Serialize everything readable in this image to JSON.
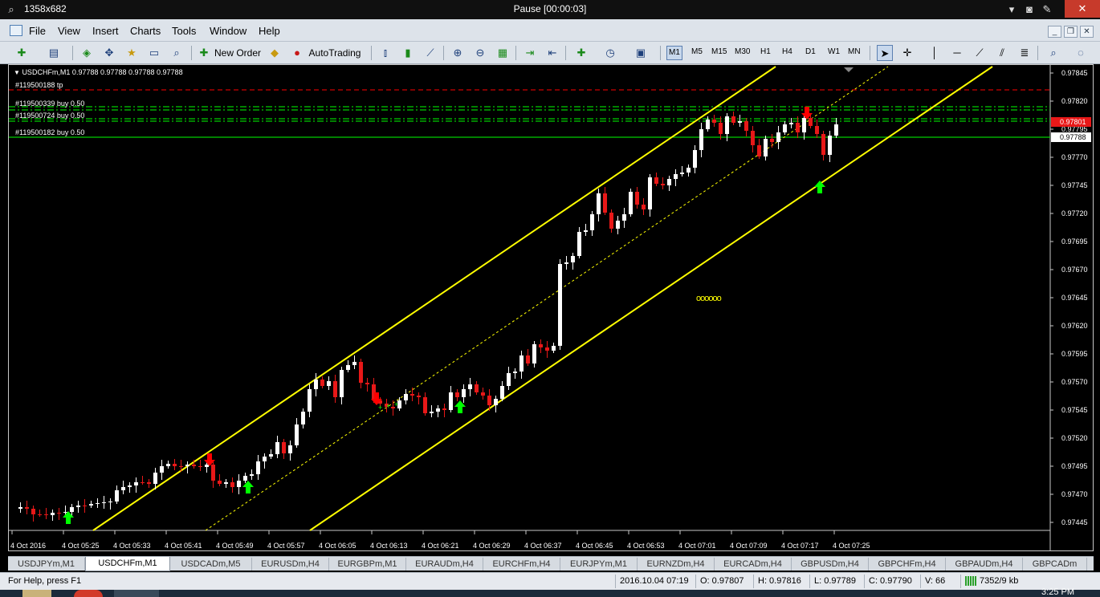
{
  "window": {
    "resolution": "1358x682",
    "status": "Pause [00:00:03]"
  },
  "menu": [
    "File",
    "View",
    "Insert",
    "Charts",
    "Tools",
    "Window",
    "Help"
  ],
  "toolbar": {
    "new_order": "New Order",
    "auto_trading": "AutoTrading",
    "timeframes": [
      "M1",
      "M5",
      "M15",
      "M30",
      "H1",
      "H4",
      "D1",
      "W1",
      "MN"
    ],
    "active_timeframe": "M1"
  },
  "chart": {
    "header": "USDCHFm,M1  0.97788 0.97788 0.97788 0.97788",
    "bid_price": "0.97788",
    "ask_price": "0.97801",
    "price_axis": [
      "0.97845",
      "0.97820",
      "0.97795",
      "0.97770",
      "0.97745",
      "0.97720",
      "0.97695",
      "0.97670",
      "0.97645",
      "0.97620",
      "0.97595",
      "0.97570",
      "0.97545",
      "0.97520",
      "0.97495",
      "0.97470",
      "0.97445"
    ],
    "time_axis": [
      "4 Oct 2016",
      "4 Oct 05:25",
      "4 Oct 05:33",
      "4 Oct 05:41",
      "4 Oct 05:49",
      "4 Oct 05:57",
      "4 Oct 06:05",
      "4 Oct 06:13",
      "4 Oct 06:21",
      "4 Oct 06:29",
      "4 Oct 06:37",
      "4 Oct 06:45",
      "4 Oct 06:53",
      "4 Oct 07:01",
      "4 Oct 07:09",
      "4 Oct 07:17",
      "4 Oct 07:25"
    ],
    "orders": [
      {
        "label": "#119500188 tp",
        "color": "#ff2a2a"
      },
      {
        "label": "#119500339 buy 0.50",
        "color": "#2ad02a"
      },
      {
        "label": "#119500724 buy 0.50",
        "color": "#2ad02a"
      },
      {
        "label": "#119500182 buy 0.50",
        "color": "#2ad02a"
      }
    ],
    "object_text": "oooooo",
    "colors": {
      "bull": "#ffffff",
      "bear": "#e81818",
      "channel": "#ffff00",
      "buy_arrow": "#00ff00",
      "sell_arrow": "#ff0000"
    }
  },
  "tabs": [
    "USDJPYm,M1",
    "USDCHFm,M1",
    "USDCADm,M5",
    "EURUSDm,H4",
    "EURGBPm,M1",
    "EURAUDm,H4",
    "EURCHFm,H4",
    "EURJPYm,M1",
    "EURNZDm,H4",
    "EURCADm,H4",
    "GBPUSDm,H4",
    "GBPCHFm,H4",
    "GBPAUDm,H4",
    "GBPCADm"
  ],
  "active_tab": "USDCHFm,M1",
  "status": {
    "help": "For Help, press F1",
    "datetime": "2016.10.04 07:19",
    "open": "O: 0.97807",
    "high": "H: 0.97816",
    "low": "L: 0.97789",
    "close": "C: 0.97790",
    "volume": "V: 66",
    "traffic": "7352/9 kb"
  },
  "taskbar": {
    "clock": "3:25 PM"
  }
}
